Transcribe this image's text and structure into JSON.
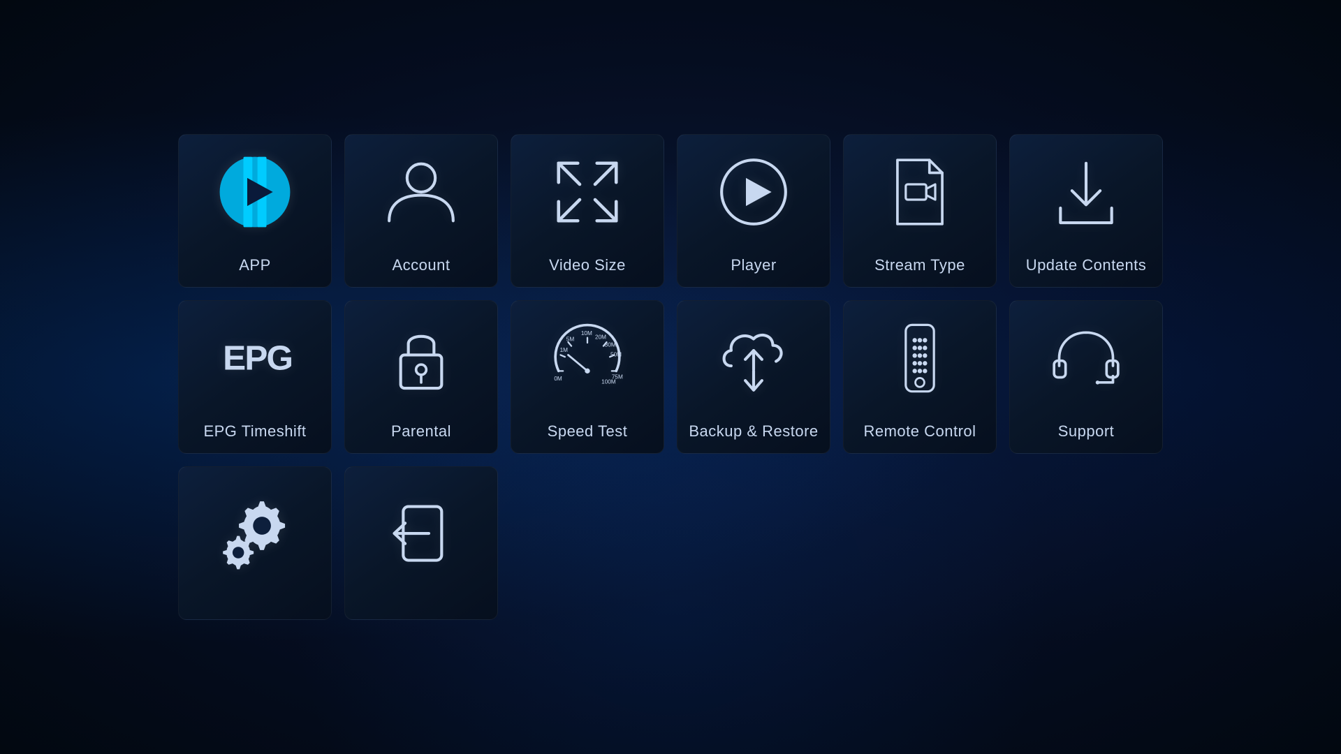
{
  "tiles": [
    {
      "id": "app",
      "label": "APP",
      "icon": "app"
    },
    {
      "id": "account",
      "label": "Account",
      "icon": "account"
    },
    {
      "id": "video-size",
      "label": "Video Size",
      "icon": "video-size"
    },
    {
      "id": "player",
      "label": "Player",
      "icon": "player"
    },
    {
      "id": "stream-type",
      "label": "Stream Type",
      "icon": "stream-type"
    },
    {
      "id": "update-contents",
      "label": "Update Contents",
      "icon": "update-contents"
    },
    {
      "id": "epg-timeshift",
      "label": "EPG Timeshift",
      "icon": "epg"
    },
    {
      "id": "parental",
      "label": "Parental",
      "icon": "parental"
    },
    {
      "id": "speed-test",
      "label": "Speed Test",
      "icon": "speed-test"
    },
    {
      "id": "backup-restore",
      "label": "Backup & Restore",
      "icon": "backup-restore"
    },
    {
      "id": "remote-control",
      "label": "Remote Control",
      "icon": "remote-control"
    },
    {
      "id": "support",
      "label": "Support",
      "icon": "support"
    },
    {
      "id": "settings",
      "label": "",
      "icon": "settings"
    },
    {
      "id": "exit",
      "label": "",
      "icon": "exit"
    }
  ]
}
